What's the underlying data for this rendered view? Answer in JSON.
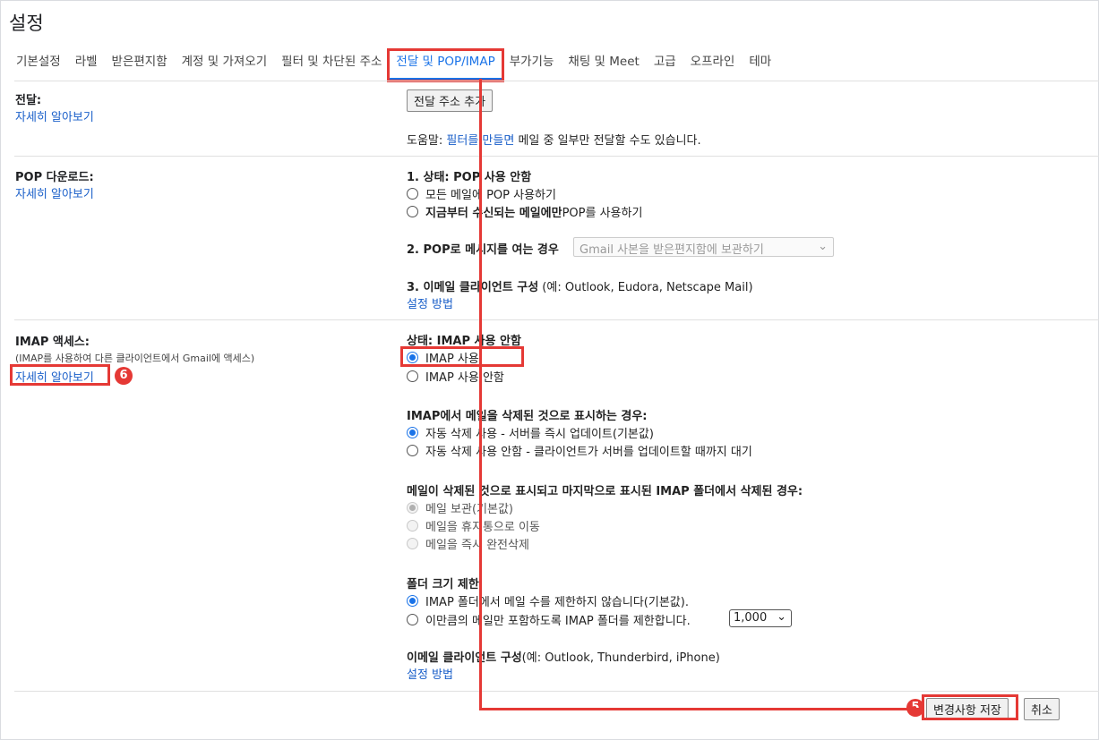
{
  "page": {
    "title": "설정"
  },
  "tabs": [
    {
      "label": "기본설정"
    },
    {
      "label": "라벨"
    },
    {
      "label": "받은편지함"
    },
    {
      "label": "계정 및 가져오기"
    },
    {
      "label": "필터 및 차단된 주소"
    },
    {
      "label": "전달 및 POP/IMAP"
    },
    {
      "label": "부가기능"
    },
    {
      "label": "채팅 및 Meet"
    },
    {
      "label": "고급"
    },
    {
      "label": "오프라인"
    },
    {
      "label": "테마"
    }
  ],
  "forwarding": {
    "label": "전달:",
    "learn_more": "자세히 알아보기",
    "add_button": "전달 주소 추가",
    "help_prefix": "도움말: ",
    "help_link": "필터를 만들면",
    "help_suffix": " 메일 중 일부만 전달할 수도 있습니다."
  },
  "pop": {
    "label": "POP 다운로드:",
    "learn_more": "자세히 알아보기",
    "status": "1. 상태: POP 사용 안함",
    "opt_all": "모든 메일에 POP 사용하기",
    "opt_from_now_bold": "지금부터 수신되는 메일에만",
    "opt_from_now_rest": " POP를 사용하기",
    "when_opened_label": "2. POP로 메시지를 여는 경우",
    "when_opened_value": "Gmail 사본을 받은편지함에 보관하기",
    "client_label": "3. 이메일 클라이언트 구성",
    "client_examples": " (예: Outlook, Eudora, Netscape Mail)",
    "setup_link": "설정 방법"
  },
  "imap": {
    "label": "IMAP 액세스:",
    "sublabel": "(IMAP를 사용하여 다른 클라이언트에서 Gmail에 액세스)",
    "learn_more": "자세히 알아보기",
    "status": "상태: IMAP 사용 안함",
    "enable": "IMAP 사용",
    "disable": "IMAP 사용 안함",
    "delete_heading": "IMAP에서 메일을 삭제된 것으로 표시하는 경우:",
    "auto_expunge_on": "자동 삭제 사용 - 서버를 즉시 업데이트(기본값)",
    "auto_expunge_off": "자동 삭제 사용 안함 - 클라이언트가 서버를 업데이트할 때까지 대기",
    "expunge_heading": "메일이 삭제된 것으로 표시되고 마지막으로 표시된 IMAP 폴더에서 삭제된 경우:",
    "archive": "메일 보관(기본값)",
    "trash": "메일을 휴지통으로 이동",
    "delete_forever": "메일을 즉시 완전삭제",
    "folder_limit_heading": "폴더 크기 제한",
    "no_limit": "IMAP 폴더에서 메일 수를 제한하지 않습니다(기본값).",
    "limit": "이만큼의 메일만 포함하도록 IMAP 폴더를 제한합니다.",
    "limit_value": "1,000",
    "client_label": "이메일 클라이언트 구성",
    "client_examples": "(예: Outlook, Thunderbird, iPhone)",
    "setup_link": "설정 방법"
  },
  "footer": {
    "save": "변경사항 저장",
    "cancel": "취소"
  },
  "annotations": {
    "badge_save": "5",
    "badge_learn": "6",
    "highlight_color": "#e53935"
  }
}
